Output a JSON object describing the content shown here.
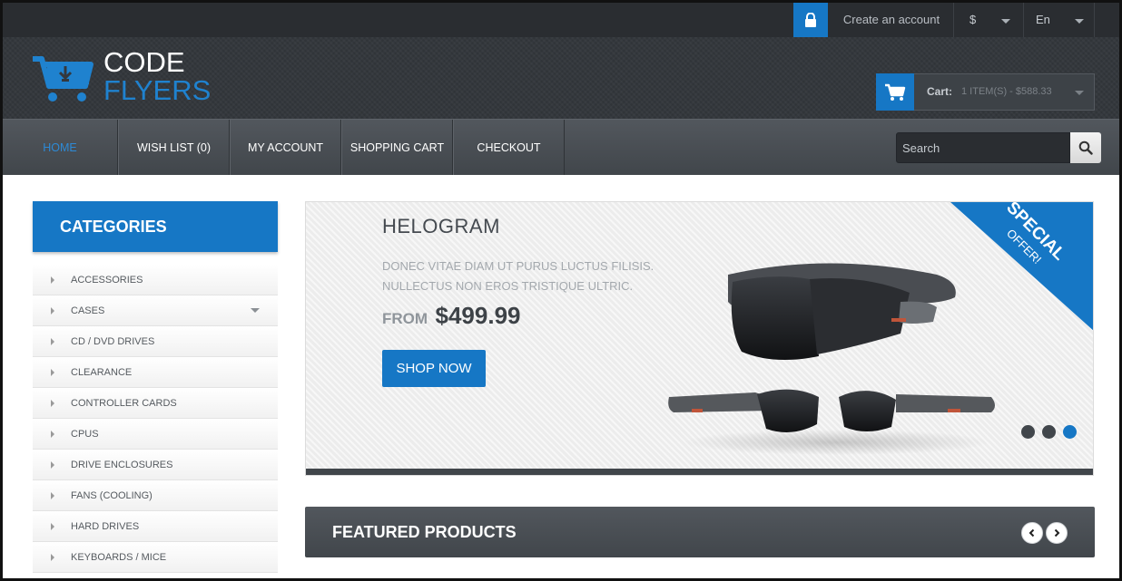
{
  "topbar": {
    "create_account": "Create an account",
    "currency": "$",
    "language": "En",
    "lock_icon": "lock-icon"
  },
  "brand": {
    "line1": "CODE",
    "line2": "FLYERS",
    "accent": "#1677c5"
  },
  "cart": {
    "label": "Cart:",
    "summary": "1 ITEM(S) - $588.33"
  },
  "nav": {
    "items": [
      {
        "label": "HOME"
      },
      {
        "label": "WISH LIST (0)"
      },
      {
        "label": "MY ACCOUNT"
      },
      {
        "label": "SHOPPING CART"
      },
      {
        "label": "CHECKOUT"
      }
    ],
    "search_placeholder": "Search"
  },
  "categories": {
    "title": "CATEGORIES",
    "items": [
      {
        "label": "ACCESSORIES"
      },
      {
        "label": "CASES"
      },
      {
        "label": "CD / DVD DRIVES"
      },
      {
        "label": "CLEARANCE"
      },
      {
        "label": "CONTROLLER CARDS"
      },
      {
        "label": "CPUS"
      },
      {
        "label": "DRIVE ENCLOSURES"
      },
      {
        "label": "FANS (COOLING)"
      },
      {
        "label": "HARD DRIVES"
      },
      {
        "label": "KEYBOARDS / MICE"
      }
    ]
  },
  "banner": {
    "title": "HELOGRAM",
    "desc_line1": "DONEC VITAE DIAM UT PURUS LUCTUS FILISIS.",
    "desc_line2": "NULLECTUS NON EROS TRISTIQUE ULTRIC.",
    "from": "FROM",
    "price": "$499.99",
    "button": "SHOP NOW",
    "ribbon_line1": "SPECIAL",
    "ribbon_line2": "OFFER!"
  },
  "featured": {
    "title": "FEATURED PRODUCTS"
  }
}
